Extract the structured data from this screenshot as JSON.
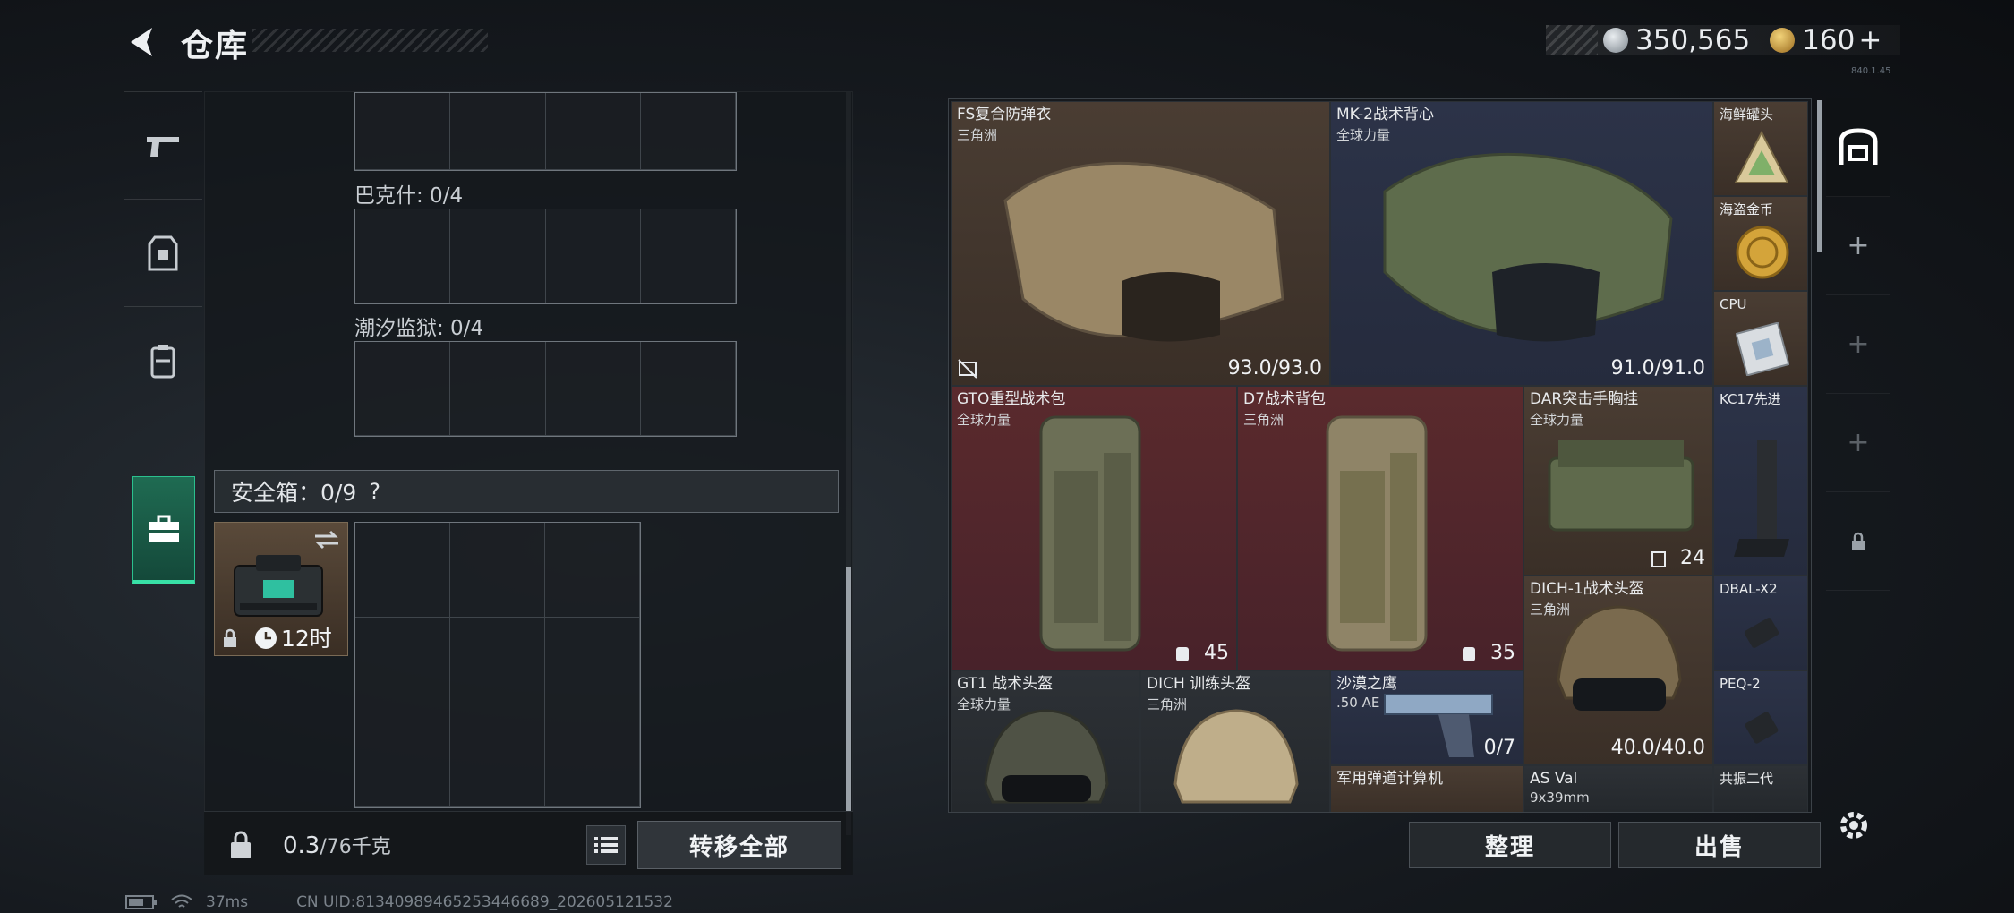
{
  "header": {
    "title": "仓库",
    "currency_silver": "350,565",
    "currency_gold": "160",
    "gold_plus": "+",
    "small_note": "840.1.45"
  },
  "left": {
    "section_baxianshi": "巴克什: 0/4",
    "section_chaoxi": "潮汐监狱: 0/4",
    "safebox_label": "安全箱：0/9",
    "safebox_help": "?",
    "safe_item_timer": "12时",
    "weight_current": "0.3",
    "weight_max": "/76千克",
    "transfer_all": "转移全部"
  },
  "stash": {
    "items": [
      {
        "name": "FS复合防弹衣",
        "sub": "三角洲",
        "val": "93.0/93.0"
      },
      {
        "name": "MK-2战术背心",
        "sub": "全球力量",
        "val": "91.0/91.0"
      },
      {
        "name": "海鲜罐头",
        "sub": "",
        "val": ""
      },
      {
        "name": "海盗金币",
        "sub": "",
        "val": ""
      },
      {
        "name": "CPU",
        "sub": "",
        "val": ""
      },
      {
        "name": "GTO重型战术包",
        "sub": "全球力量",
        "val": "45"
      },
      {
        "name": "D7战术背包",
        "sub": "三角洲",
        "val": "35"
      },
      {
        "name": "DAR突击手胸挂",
        "sub": "全球力量",
        "val": "24"
      },
      {
        "name": "KC17先进",
        "sub": "",
        "val": ""
      },
      {
        "name": "DICH-1战术头盔",
        "sub": "三角洲",
        "val": "40.0/40.0"
      },
      {
        "name": "DBAL-X2",
        "sub": "",
        "val": ""
      },
      {
        "name": "GT1 战术头盔",
        "sub": "全球力量",
        "val": ""
      },
      {
        "name": "DICH 训练头盔",
        "sub": "三角洲",
        "val": ""
      },
      {
        "name": "沙漠之鹰",
        "sub": ".50 AE",
        "val": "0/7"
      },
      {
        "name": "PEQ-2",
        "sub": "",
        "val": ""
      },
      {
        "name": "军用弹道计算机",
        "sub": "",
        "val": ""
      },
      {
        "name": "AS Val",
        "sub": "9x39mm",
        "val": ""
      },
      {
        "name": "共振二代",
        "sub": "",
        "val": ""
      }
    ],
    "sort_label": "整理",
    "sell_label": "出售"
  },
  "status": {
    "ping": "37ms",
    "uid": "CN UID:8134098946525344668​9_202605121532"
  },
  "colors": {
    "accent_green": "#38e0a6",
    "item_brown": "#4a3d33",
    "item_navy": "#2c3348",
    "item_red": "#5a2a2d"
  }
}
